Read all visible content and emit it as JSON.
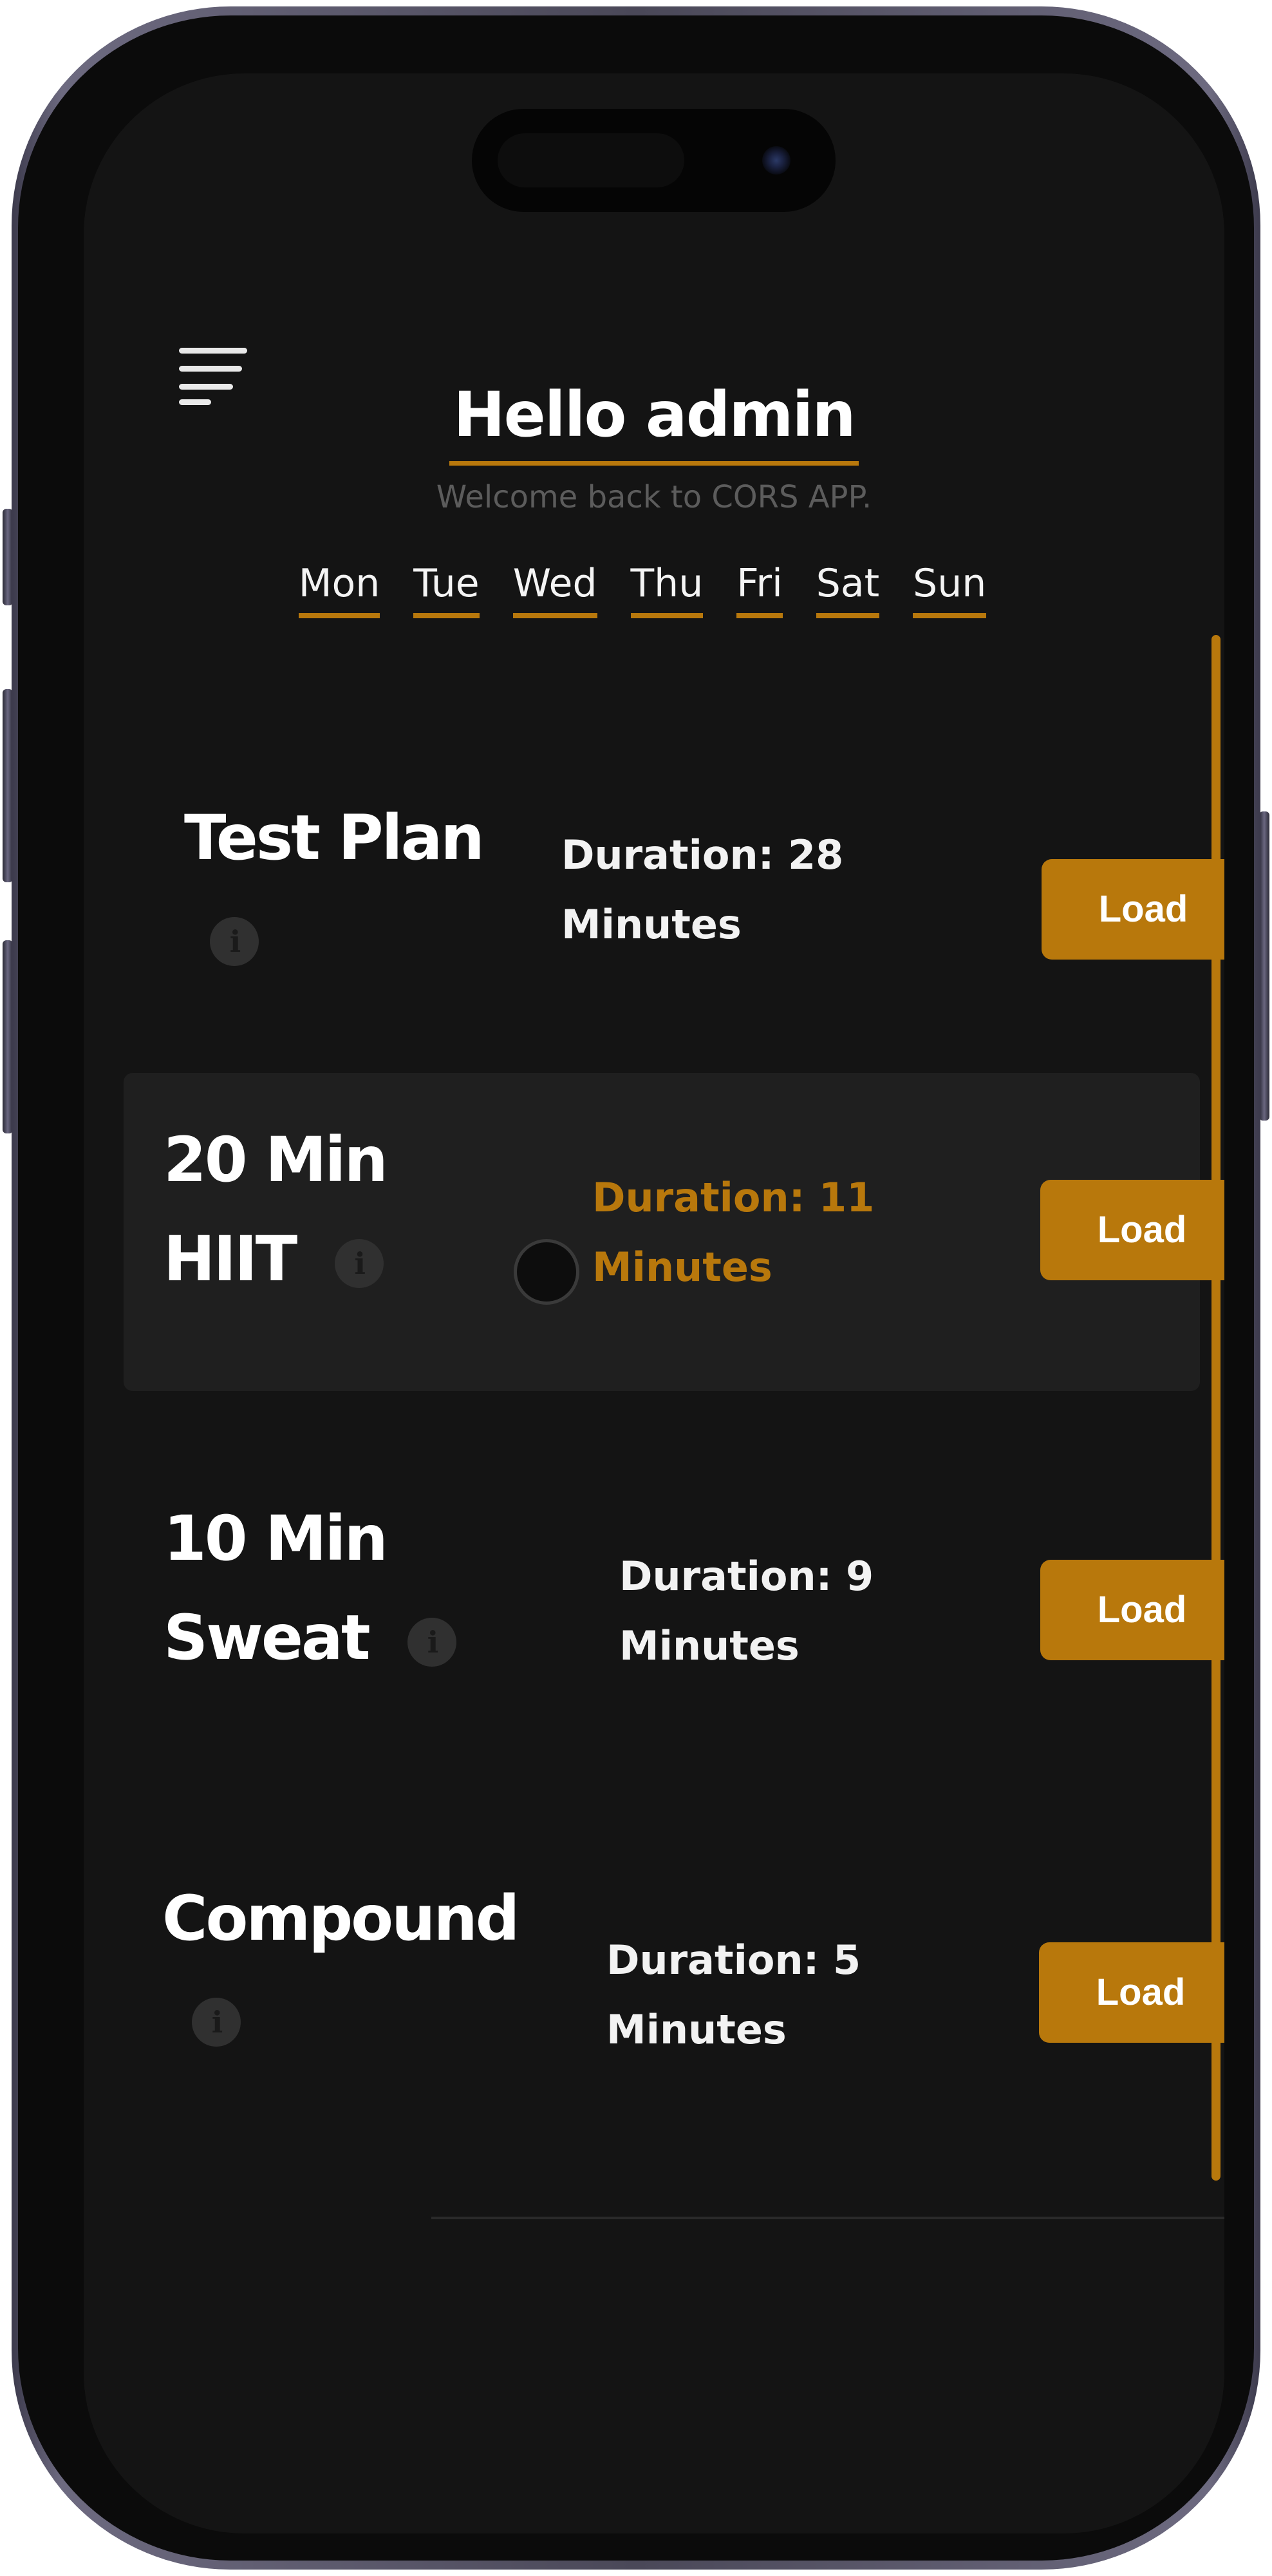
{
  "colors": {
    "accent": "#b8780c",
    "screen_bg": "#141414",
    "row_highlight_bg": "#1f1f1f",
    "text_primary": "#ffffff",
    "text_muted": "#5c5c5c"
  },
  "header": {
    "menu_icon": "hamburger-menu-icon",
    "title": "Hello admin",
    "subtitle": "Welcome back to CORS APP."
  },
  "days": [
    "Mon",
    "Tue",
    "Wed",
    "Thu",
    "Fri",
    "Sat",
    "Sun"
  ],
  "plans": [
    {
      "name": "Test Plan",
      "duration_line1": "Duration: 28",
      "duration_line2": "Minutes",
      "button": "Load",
      "info_icon": "info-icon",
      "highlighted": false
    },
    {
      "name_line1": "20 Min",
      "name_line2": "HIIT",
      "duration_line1": "Duration: 11",
      "duration_line2": "Minutes",
      "button": "Load",
      "info_icon": "info-icon",
      "highlighted": true
    },
    {
      "name_line1": "10 Min",
      "name_line2": "Sweat",
      "duration_line1": "Duration: 9",
      "duration_line2": "Minutes",
      "button": "Load",
      "info_icon": "info-icon",
      "highlighted": false
    },
    {
      "name": "Compound",
      "duration_line1": "Duration: 5",
      "duration_line2": "Minutes",
      "button": "Load",
      "info_icon": "info-icon",
      "highlighted": false
    }
  ]
}
